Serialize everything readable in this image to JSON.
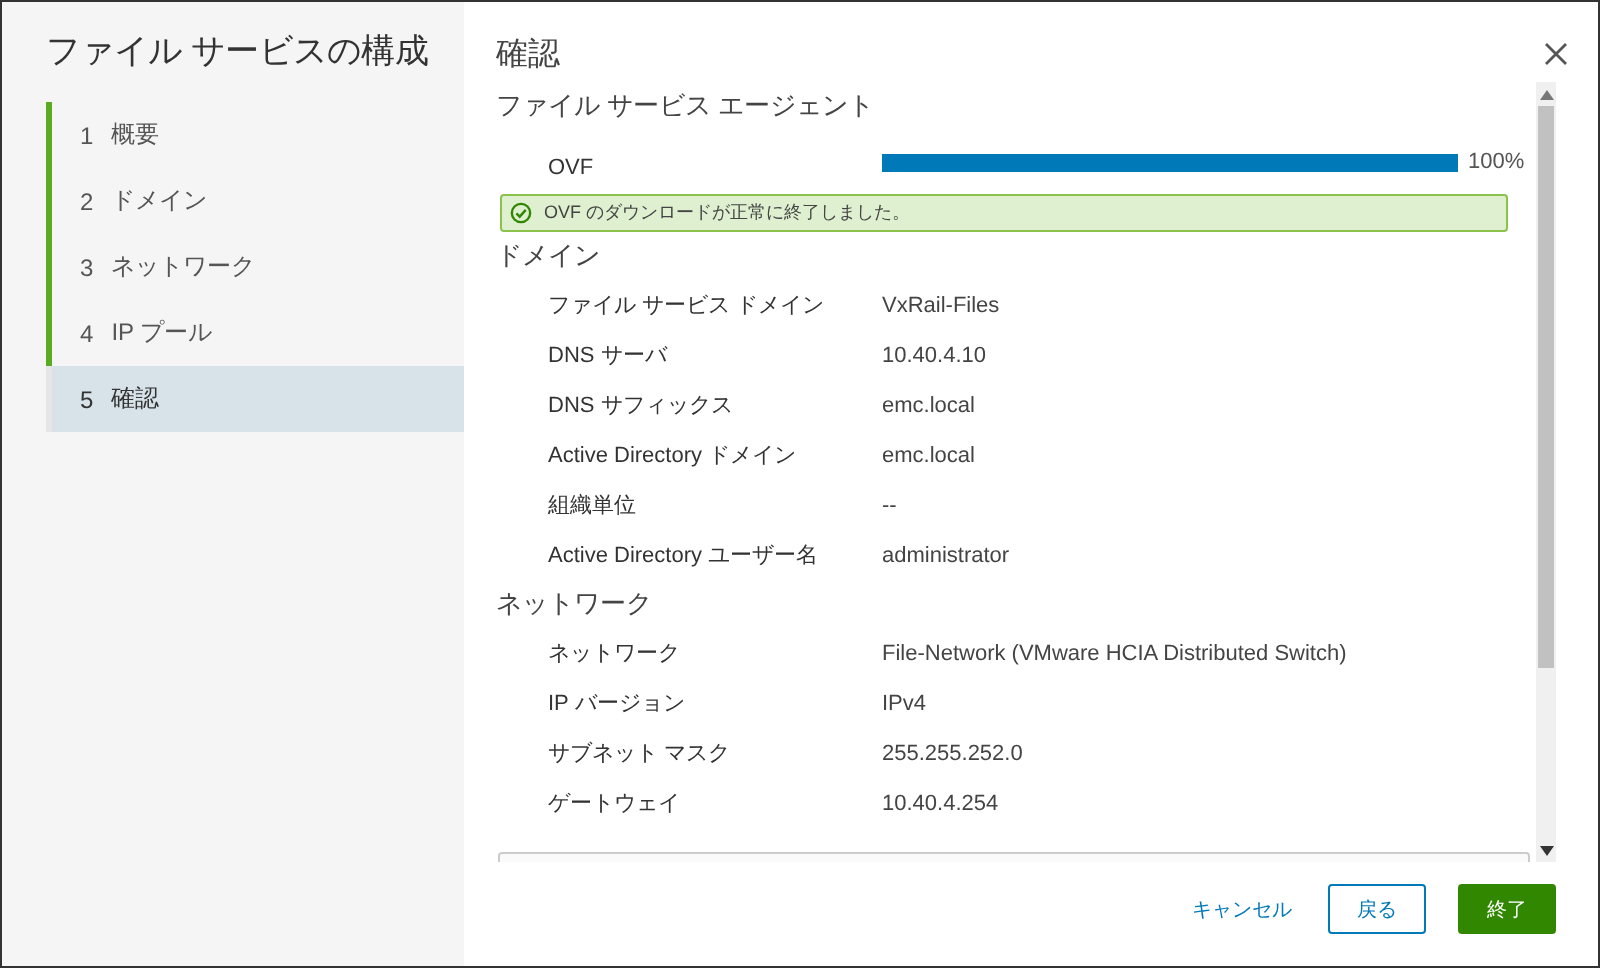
{
  "wizard": {
    "title": "ファイル サービスの構成",
    "steps": [
      {
        "number": "1",
        "label": "概要",
        "completed": true,
        "selected": false
      },
      {
        "number": "2",
        "label": "ドメイン",
        "completed": true,
        "selected": false
      },
      {
        "number": "3",
        "label": "ネットワーク",
        "completed": true,
        "selected": false
      },
      {
        "number": "4",
        "label": "IP プール",
        "completed": true,
        "selected": false
      },
      {
        "number": "5",
        "label": "確認",
        "completed": false,
        "selected": true
      }
    ]
  },
  "page": {
    "title": "確認",
    "sections": [
      {
        "title": "ファイル サービス エージェント",
        "rows": [
          {
            "kind": "progress",
            "label": "OVF",
            "level": 1,
            "reading": "100%"
          },
          {
            "kind": "alert",
            "text": "OVF のダウンロードが正常に終了しました。"
          }
        ]
      },
      {
        "title": "ドメイン",
        "rows": [
          {
            "kind": "field",
            "label": "ファイル サービス ドメイン",
            "value": "VxRail-Files"
          },
          {
            "kind": "field",
            "label": "DNS サーバ",
            "value": "10.40.4.10"
          },
          {
            "kind": "field",
            "label": "DNS サフィックス",
            "value": "emc.local"
          },
          {
            "kind": "field",
            "label": "Active Directory ドメイン",
            "value": "emc.local"
          },
          {
            "kind": "field",
            "label": "組織単位",
            "value": "--"
          },
          {
            "kind": "field",
            "label": "Active Directory ユーザー名",
            "value": "administrator"
          }
        ]
      },
      {
        "title": "ネットワーク",
        "rows": [
          {
            "kind": "field",
            "label": "ネットワーク",
            "value": "File-Network (VMware HCIA Distributed Switch)"
          },
          {
            "kind": "field",
            "label": "IP バージョン",
            "value": "IPv4"
          },
          {
            "kind": "field",
            "label": "サブネット マスク",
            "value": "255.255.252.0"
          },
          {
            "kind": "field",
            "label": "ゲートウェイ",
            "value": "10.40.4.254"
          },
          {
            "kind": "table"
          }
        ]
      }
    ]
  },
  "buttons": [
    {
      "kind": "link",
      "label": "キャンセル"
    },
    {
      "kind": "outline",
      "label": "戻る"
    },
    {
      "kind": "primary",
      "label": "終了"
    }
  ]
}
